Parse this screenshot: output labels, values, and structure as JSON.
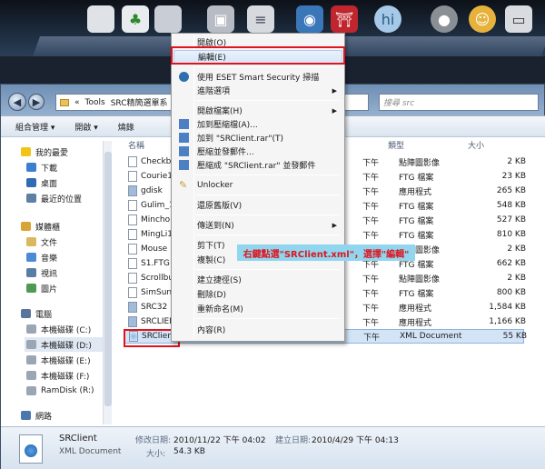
{
  "window": {
    "address": [
      "«",
      "Tools",
      "SRC精簡選單系"
    ],
    "search_placeholder": "搜尋 src",
    "toolbar": [
      "組合管理 ▾",
      "開啟 ▾",
      "燒錄"
    ]
  },
  "sidebar": {
    "items": [
      {
        "label": "我的最愛",
        "icon": "star-icon",
        "color": "#f0c419"
      },
      {
        "label": "下載",
        "icon": "download-folder-icon",
        "color": "#3b7fd0"
      },
      {
        "label": "桌面",
        "icon": "desktop-icon",
        "color": "#2f6cb3"
      },
      {
        "label": "最近的位置",
        "icon": "recent-places-icon",
        "color": "#5f7fa3"
      },
      {
        "label": "媒體櫃",
        "icon": "library-icon",
        "color": "#d9a336"
      },
      {
        "label": "文件",
        "icon": "documents-icon",
        "color": "#d9b860"
      },
      {
        "label": "音樂",
        "icon": "music-icon",
        "color": "#4d8ad6"
      },
      {
        "label": "視訊",
        "icon": "video-icon",
        "color": "#5a7da6"
      },
      {
        "label": "圖片",
        "icon": "pictures-icon",
        "color": "#4e9a55"
      },
      {
        "label": "電腦",
        "icon": "computer-icon",
        "color": "#58749a"
      },
      {
        "label": "本機磁碟 (C:)",
        "icon": "drive-icon",
        "color": "#9aa6b4"
      },
      {
        "label": "本機磁碟 (D:)",
        "icon": "drive-icon",
        "color": "#9aa6b4"
      },
      {
        "label": "本機磁碟 (E:)",
        "icon": "drive-icon",
        "color": "#9aa6b4"
      },
      {
        "label": "本機磁碟 (F:)",
        "icon": "drive-icon",
        "color": "#9aa6b4"
      },
      {
        "label": "RamDisk (R:)",
        "icon": "drive-icon",
        "color": "#9aa6b4"
      },
      {
        "label": "網路",
        "icon": "network-icon",
        "color": "#4a78ad"
      }
    ]
  },
  "columns": {
    "name": "名稱",
    "type": "類型",
    "size": "大小"
  },
  "files": [
    {
      "name": "Checkbc",
      "date": "下午",
      "type": "點陣圖影像",
      "size": "2 KB"
    },
    {
      "name": "Courie1",
      "date": "下午",
      "type": "FTG 檔案",
      "size": "23 KB"
    },
    {
      "name": "gdisk",
      "date": "下午",
      "type": "應用程式",
      "size": "265 KB"
    },
    {
      "name": "Gulim_1",
      "date": "下午",
      "type": "FTG 檔案",
      "size": "548 KB"
    },
    {
      "name": "Mincho1",
      "date": "下午",
      "type": "FTG 檔案",
      "size": "527 KB"
    },
    {
      "name": "MingLi1",
      "date": "下午",
      "type": "FTG 檔案",
      "size": "810 KB"
    },
    {
      "name": "Mouse",
      "date": "下午",
      "type": "點陣圖影像",
      "size": "2 KB"
    },
    {
      "name": "S1.FTG",
      "date": "下午",
      "type": "FTG 檔案",
      "size": "662 KB"
    },
    {
      "name": "Scrollbu",
      "date": "下午",
      "type": "點陣圖影像",
      "size": "2 KB"
    },
    {
      "name": "SimSun1",
      "date": "下午",
      "type": "FTG 檔案",
      "size": "800 KB"
    },
    {
      "name": "SRC32",
      "date": "下午",
      "type": "應用程式",
      "size": "1,584 KB"
    },
    {
      "name": "SRCLIEN",
      "date": "下午",
      "type": "應用程式",
      "size": "1,166 KB"
    },
    {
      "name": "SRClient",
      "date": "下午",
      "type": "XML Document",
      "size": "55 KB"
    }
  ],
  "context_menu": {
    "items": [
      {
        "label": "開啟(O)",
        "arrow": false
      },
      {
        "label": "編輯(E)",
        "arrow": false
      },
      {
        "label": "使用 ESET Smart Security 掃描",
        "arrow": false
      },
      {
        "label": "進階選項",
        "arrow": true
      },
      {
        "label": "開啟檔案(H)",
        "arrow": true
      },
      {
        "label": "加到壓縮檔(A)...",
        "arrow": false
      },
      {
        "label": "加到 \"SRClient.rar\"(T)",
        "arrow": false
      },
      {
        "label": "壓縮並發郵件...",
        "arrow": false
      },
      {
        "label": "壓縮成 \"SRClient.rar\" 並發郵件",
        "arrow": false
      },
      {
        "label": "Unlocker",
        "arrow": false
      },
      {
        "label": "還原舊版(V)",
        "arrow": false
      },
      {
        "label": "傳送到(N)",
        "arrow": true
      },
      {
        "label": "剪下(T)",
        "arrow": false
      },
      {
        "label": "複製(C)",
        "arrow": false
      },
      {
        "label": "建立捷徑(S)",
        "arrow": false
      },
      {
        "label": "刪除(D)",
        "arrow": false
      },
      {
        "label": "重新命名(M)",
        "arrow": false
      },
      {
        "label": "內容(R)",
        "arrow": false
      }
    ]
  },
  "annotation": "右鍵點選\"SRClient.xml\"，選擇\"編輯\"",
  "details": {
    "name": "SRClient",
    "type": "XML Document",
    "modified_label": "修改日期:",
    "modified": "2010/11/22 下午 04:02",
    "created_label": "建立日期:",
    "created": "2010/4/29 下午 04:13",
    "size_label": "大小:",
    "size": "54.3 KB"
  },
  "colors": {
    "highlight_red": "#e0141e",
    "callout_bg": "#8fd6ee"
  }
}
